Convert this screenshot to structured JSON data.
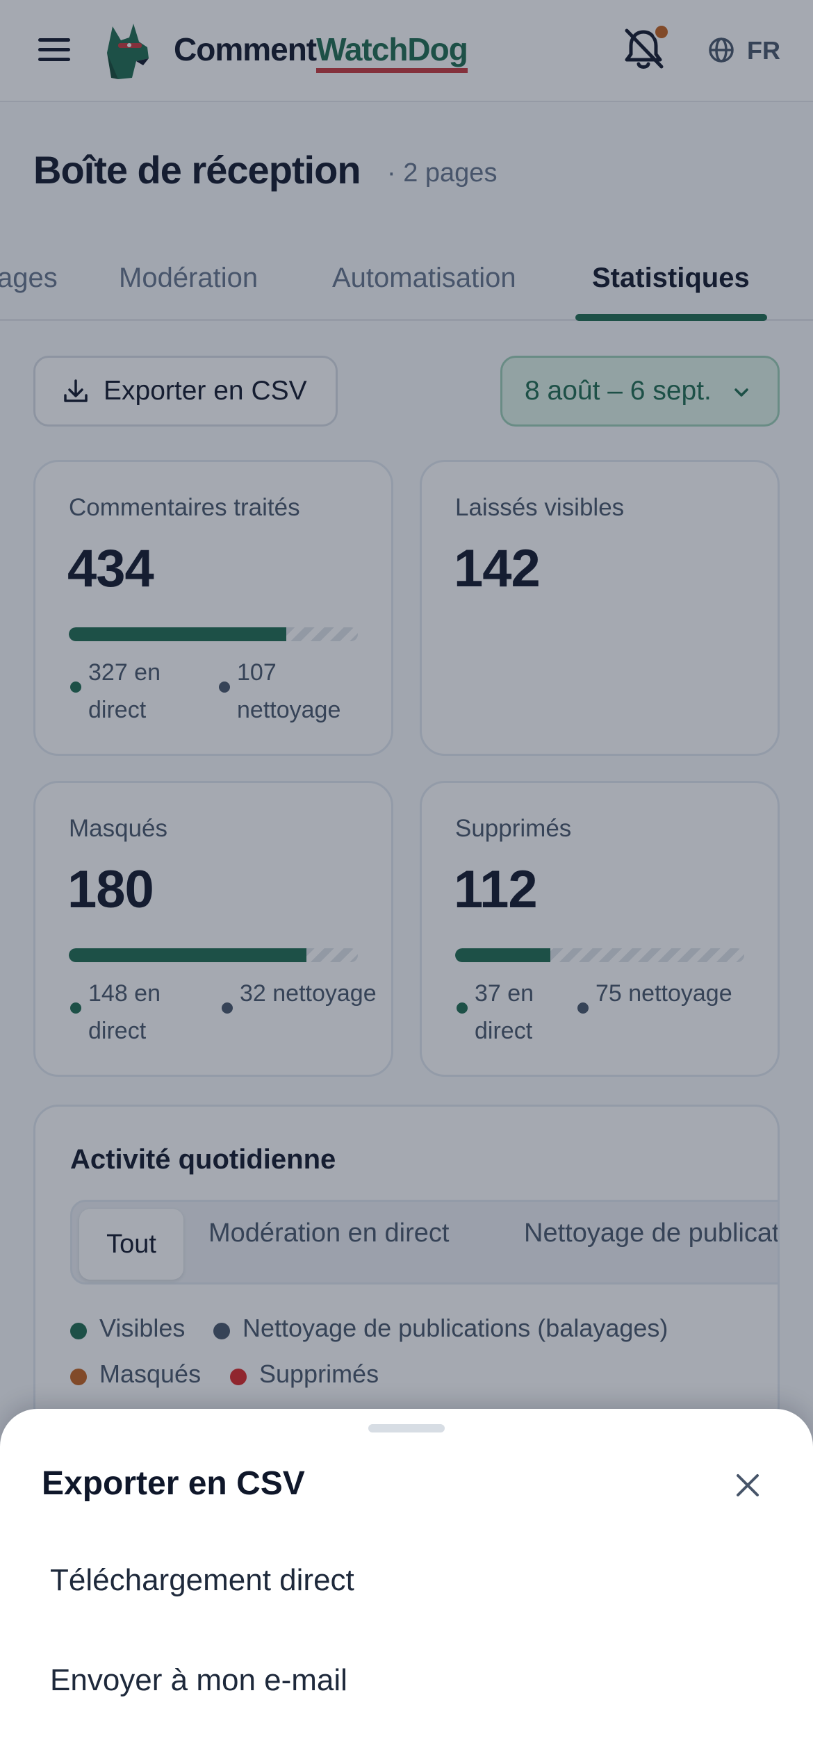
{
  "header": {
    "brand_part1": "Comment",
    "brand_part2": "WatchDog",
    "language": "FR",
    "icons": [
      "menu-icon",
      "dog-logo-icon",
      "bell-off-icon",
      "globe-icon"
    ]
  },
  "page": {
    "title": "Boîte de réception",
    "subtitle": "· 2 pages"
  },
  "tabs": [
    {
      "label": "Pages",
      "visible_text": "ages",
      "active": false
    },
    {
      "label": "Modération",
      "active": false
    },
    {
      "label": "Automatisation",
      "active": false
    },
    {
      "label": "Statistiques",
      "active": true
    }
  ],
  "toolbar": {
    "export_label": "Exporter en CSV",
    "date_range": "8 août – 6 sept."
  },
  "stats": [
    {
      "label": "Commentaires traités",
      "value": "434",
      "live": "327 en direct",
      "cleanup": "107 nettoyage",
      "live_fraction": 0.753
    },
    {
      "label": "Laissés visibles",
      "value": "142"
    },
    {
      "label": "Masqués",
      "value": "180",
      "live": "148 en direct",
      "cleanup": "32 nettoyage",
      "live_fraction": 0.822
    },
    {
      "label": "Supprimés",
      "value": "112",
      "live": "37 en direct",
      "cleanup": "75 nettoyage",
      "live_fraction": 0.33
    }
  ],
  "activity": {
    "title": "Activité quotidienne",
    "filters": [
      "Tout",
      "Modération en direct",
      "Nettoyage de publications"
    ],
    "legend": [
      "Visibles",
      "Nettoyage de publications (balayages)",
      "Masqués",
      "Supprimés"
    ]
  },
  "colors": {
    "primary": "#1d6b4f",
    "accent_red": "#c8373d",
    "orange": "#c4621d",
    "red": "#dc2626",
    "slate": "#475569"
  },
  "sheet": {
    "title": "Exporter en CSV",
    "options": [
      "Téléchargement direct",
      "Envoyer à mon e-mail"
    ]
  }
}
